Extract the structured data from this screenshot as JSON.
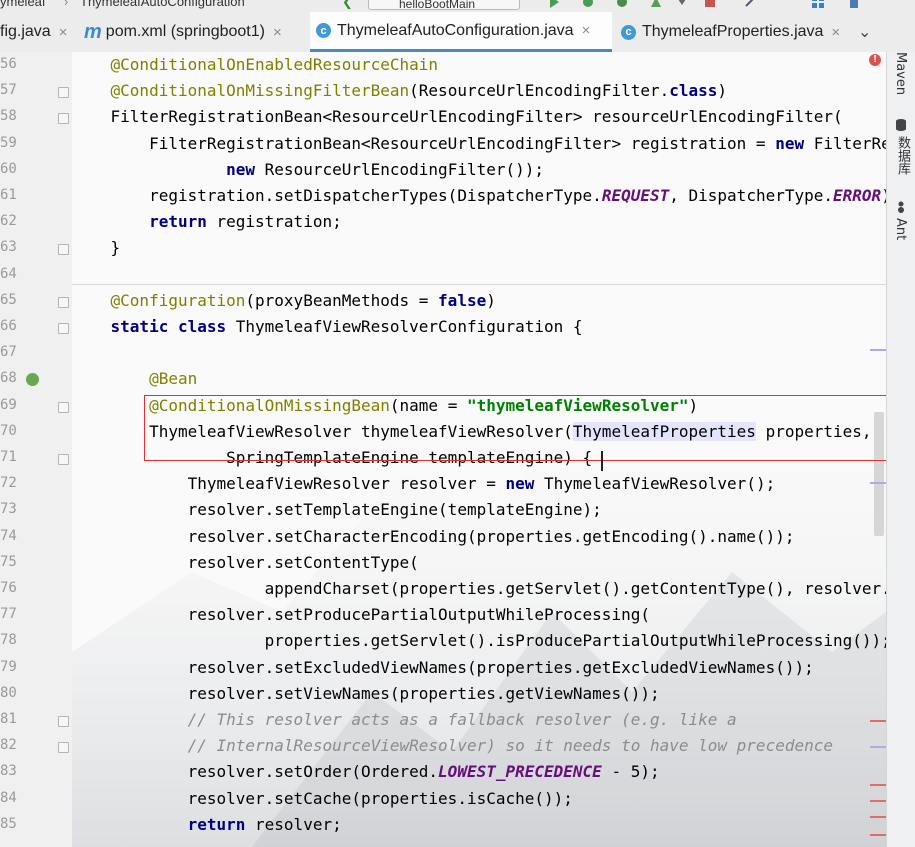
{
  "top_strip": {
    "crumb1": "ymeleaf",
    "crumb2": "ThymeleafAutoConfiguration",
    "run_config": "helloBootMain"
  },
  "tabs": [
    {
      "label": "fig.java",
      "icon": "java-file-icon"
    },
    {
      "label": "pom.xml (springboot1)",
      "icon": "maven-icon"
    },
    {
      "label": "ThymeleafAutoConfiguration.java",
      "icon": "class-icon",
      "active": true
    },
    {
      "label": "ThymeleafProperties.java",
      "icon": "class-icon"
    }
  ],
  "tab_close_glyph": "×",
  "tab_menu_glyph": "⌄",
  "class_icon_letter": "c",
  "maven_icon_letter": "m",
  "line_numbers": [
    "56",
    "57",
    "58",
    "59",
    "60",
    "61",
    "62",
    "63",
    "64",
    "65",
    "66",
    "67",
    "68",
    "69",
    "70",
    "71",
    "72",
    "73",
    "74",
    "75",
    "76",
    "77",
    "78",
    "79",
    "80",
    "81",
    "82",
    "83",
    "84",
    "85"
  ],
  "code_lines": [
    [
      {
        "t": "    "
      },
      {
        "t": "@ConditionalOnEnabledResourceChain",
        "c": "an"
      }
    ],
    [
      {
        "t": "    "
      },
      {
        "t": "@ConditionalOnMissingFilterBean",
        "c": "an"
      },
      {
        "t": "(ResourceUrlEncodingFilter."
      },
      {
        "t": "class",
        "c": "kw"
      },
      {
        "t": ")"
      }
    ],
    [
      {
        "t": "    FilterRegistrationBean<ResourceUrlEncodingFilter> resourceUrlEncodingFilter("
      }
    ],
    [
      {
        "t": "        FilterRegistrationBean<ResourceUrlEncodingFilter> registration = "
      },
      {
        "t": "new",
        "c": "kw"
      },
      {
        "t": " FilterRegistrationBean<>("
      }
    ],
    [
      {
        "t": "                "
      },
      {
        "t": "new",
        "c": "kw"
      },
      {
        "t": " ResourceUrlEncodingFilter());"
      }
    ],
    [
      {
        "t": "        registration.setDispatcherTypes(DispatcherType."
      },
      {
        "t": "REQUEST",
        "c": "fi"
      },
      {
        "t": ", DispatcherType."
      },
      {
        "t": "ERROR",
        "c": "fi"
      },
      {
        "t": ");"
      }
    ],
    [
      {
        "t": "        "
      },
      {
        "t": "return",
        "c": "kw"
      },
      {
        "t": " registration;"
      }
    ],
    [
      {
        "t": "    }"
      }
    ],
    [
      {
        "t": ""
      }
    ],
    [
      {
        "t": "    "
      },
      {
        "t": "@Configuration",
        "c": "an"
      },
      {
        "t": "(proxyBeanMethods = "
      },
      {
        "t": "false",
        "c": "kw"
      },
      {
        "t": ")"
      }
    ],
    [
      {
        "t": "    "
      },
      {
        "t": "static class",
        "c": "kw"
      },
      {
        "t": " ThymeleafViewResolverConfiguration {"
      }
    ],
    [
      {
        "t": ""
      }
    ],
    [
      {
        "t": "        "
      },
      {
        "t": "@Bean",
        "c": "an"
      }
    ],
    [
      {
        "t": "        "
      },
      {
        "t": "@ConditionalOnMissingBean",
        "c": "an"
      },
      {
        "t": "(name = "
      },
      {
        "t": "\"thymeleafViewResolver\"",
        "c": "st"
      },
      {
        "t": ")"
      }
    ],
    [
      {
        "t": "        ThymeleafViewResolver thymeleafViewResolver("
      },
      {
        "t": "ThymeleafProperties",
        "c": "hl"
      },
      {
        "t": " properties,"
      }
    ],
    [
      {
        "t": "                SpringTemplateEngine templateEngine) {"
      }
    ],
    [
      {
        "t": "            ThymeleafViewResolver resolver = "
      },
      {
        "t": "new",
        "c": "kw"
      },
      {
        "t": " ThymeleafViewResolver();"
      }
    ],
    [
      {
        "t": "            resolver.setTemplateEngine(templateEngine);"
      }
    ],
    [
      {
        "t": "            resolver.setCharacterEncoding(properties.getEncoding().name());"
      }
    ],
    [
      {
        "t": "            resolver.setContentType("
      }
    ],
    [
      {
        "t": "                    appendCharset(properties.getServlet().getContentType(), resolver.getCharacterEncoding()));"
      }
    ],
    [
      {
        "t": "            resolver.setProducePartialOutputWhileProcessing("
      }
    ],
    [
      {
        "t": "                    properties.getServlet().isProducePartialOutputWhileProcessing());"
      }
    ],
    [
      {
        "t": "            resolver.setExcludedViewNames(properties.getExcludedViewNames());"
      }
    ],
    [
      {
        "t": "            resolver.setViewNames(properties.getViewNames());"
      }
    ],
    [
      {
        "t": "            "
      },
      {
        "t": "// This resolver acts as a fallback resolver (e.g. like a",
        "c": "cm"
      }
    ],
    [
      {
        "t": "            "
      },
      {
        "t": "// InternalResourceViewResolver) so it needs to have low precedence",
        "c": "cm"
      }
    ],
    [
      {
        "t": "            resolver.setOrder(Ordered."
      },
      {
        "t": "LOWEST_PRECEDENCE",
        "c": "fi"
      },
      {
        "t": " - 5);"
      }
    ],
    [
      {
        "t": "            resolver.setCache(properties.isCache());"
      }
    ],
    [
      {
        "t": "            "
      },
      {
        "t": "return",
        "c": "kw"
      },
      {
        "t": " resolver;"
      }
    ]
  ],
  "right_panel": {
    "maven": "Maven",
    "database": "数据库",
    "ant": "Ant"
  },
  "colors": {
    "keyword": "#000080",
    "annotation": "#808000",
    "string": "#008000",
    "static_field": "#660e7a",
    "comment": "#8c8c8c",
    "highlight_box": "#e03030",
    "tab_underline": "#4a87c5"
  }
}
